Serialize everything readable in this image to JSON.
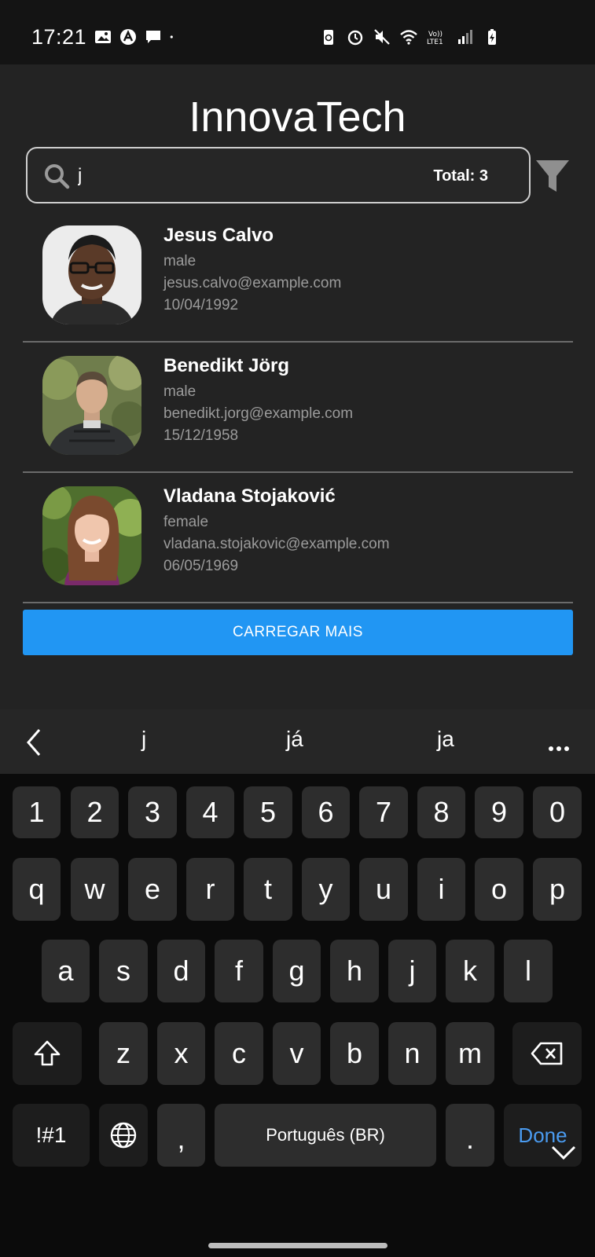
{
  "status_bar": {
    "time": "17:21",
    "left_icons": [
      "image-icon",
      "app-a-icon",
      "chat-icon",
      "dot-icon"
    ],
    "right_icons": [
      "battery-saver-icon",
      "alarm-icon",
      "mute-icon",
      "wifi-icon",
      "volte-icon",
      "signal-icon",
      "battery-charging-icon"
    ]
  },
  "app": {
    "title": "InnovaTech",
    "search": {
      "value": "j",
      "total_label": "Total: 3"
    },
    "filter_icon": "filter-icon",
    "users": [
      {
        "name": "Jesus Calvo",
        "gender": "male",
        "email": "jesus.calvo@example.com",
        "dob": "10/04/1992"
      },
      {
        "name": "Benedikt Jörg",
        "gender": "male",
        "email": "benedikt.jorg@example.com",
        "dob": "15/12/1958"
      },
      {
        "name": "Vladana Stojaković",
        "gender": "female",
        "email": "vladana.stojakovic@example.com",
        "dob": "06/05/1969"
      }
    ],
    "load_more_label": "CARREGAR MAIS"
  },
  "keyboard": {
    "suggestions": [
      "j",
      "já",
      "ja"
    ],
    "number_row": [
      "1",
      "2",
      "3",
      "4",
      "5",
      "6",
      "7",
      "8",
      "9",
      "0"
    ],
    "row1": [
      "q",
      "w",
      "e",
      "r",
      "t",
      "y",
      "u",
      "i",
      "o",
      "p"
    ],
    "row2": [
      "a",
      "s",
      "d",
      "f",
      "g",
      "h",
      "j",
      "k",
      "l"
    ],
    "row3": [
      "z",
      "x",
      "c",
      "v",
      "b",
      "n",
      "m"
    ],
    "symbols_label": "!#1",
    "comma_label": ",",
    "space_label": "Português (BR)",
    "period_label": ".",
    "done_label": "Done"
  },
  "colors": {
    "background": "#232323",
    "accent": "#2196f3",
    "done_text": "#4a9bf0",
    "muted_text": "#9b9b9b"
  }
}
